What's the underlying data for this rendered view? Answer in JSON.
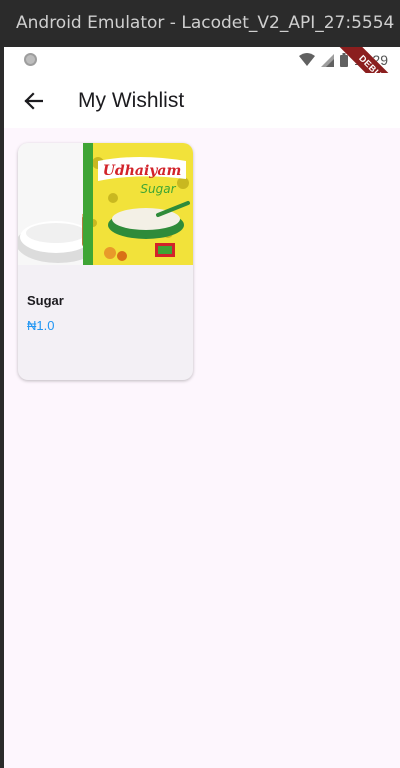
{
  "window": {
    "title": "Android Emulator - Lacodet_V2_API_27:5554"
  },
  "status_bar": {
    "time": "11:29",
    "debug_banner": "DEBUG"
  },
  "app_bar": {
    "title": "My Wishlist"
  },
  "wishlist": {
    "items": [
      {
        "name": "Sugar",
        "price": "₦1.0",
        "image_brand": "Udhaiyam",
        "image_product": "Sugar"
      }
    ]
  },
  "colors": {
    "price": "#2196f3",
    "screen_bg": "#fdf6fd",
    "card_bg": "#f3f0f5"
  }
}
